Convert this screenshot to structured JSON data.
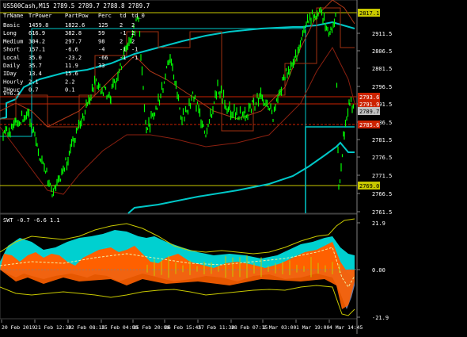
{
  "header": {
    "symbol_line": "US500Cash,M15  2789.5 2789.7 2788.8 2789.7"
  },
  "stats": {
    "columns": [
      "TrName",
      "TrPower",
      "PartPow",
      "Perc",
      "td",
      "td_0"
    ],
    "rows": [
      [
        "Basic",
        "1459.8",
        "1822.6",
        "125",
        "2",
        "2"
      ],
      [
        "Long",
        "616.9",
        "382.8",
        "59",
        "-1",
        "2"
      ],
      [
        "Medium",
        "304.2",
        "297.7",
        "98",
        "2",
        "2"
      ],
      [
        "Short",
        "157.1",
        "-6.6",
        "-4",
        "-1",
        "-1"
      ],
      [
        "Local",
        "35.0",
        "-23.2",
        "-66",
        "-1",
        "-1"
      ],
      [
        "Daily",
        "35.7",
        "11.9",
        "33",
        "",
        ""
      ],
      [
        "IDay",
        "13.4",
        "15.6",
        "",
        "",
        ""
      ],
      [
        "Hourly",
        "2.1",
        "2.2",
        "",
        "",
        ""
      ],
      [
        "IHour",
        "0.7",
        "0.1",
        "",
        "",
        ""
      ]
    ],
    "footer": "V=6.3"
  },
  "price_axis": {
    "ticks": [
      "2911.5",
      "2806.5",
      "2801.5",
      "2796.5",
      "2791.5",
      "2786.5",
      "2781.5",
      "2776.5",
      "2771.5",
      "2766.5",
      "2761.5"
    ],
    "tags": [
      {
        "text": "2817.1",
        "bg": "#c8c800",
        "fg": "#000000"
      },
      {
        "text": "2793.6",
        "bg": "#cc2200",
        "fg": "#ffffff"
      },
      {
        "text": "2791.9",
        "bg": "#cc2200",
        "fg": "#ffffff"
      },
      {
        "text": "2789.7",
        "bg": "#c0c0c0",
        "fg": "#000000"
      },
      {
        "text": "2785.6",
        "bg": "#cc2200",
        "fg": "#ffffff"
      },
      {
        "text": "2769.0",
        "bg": "#c8c800",
        "fg": "#000000"
      }
    ]
  },
  "sub_window": {
    "label": "SWT -0.7 -6.6 1.1",
    "ticks": [
      "21.9",
      "0.00",
      "-21.9"
    ]
  },
  "time_axis": {
    "labels": [
      "20 Feb 2019",
      "21 Feb 12:30",
      "22 Feb 08:15",
      "25 Feb 04:00",
      "25 Feb 20:00",
      "26 Feb 15:45",
      "27 Feb 11:30",
      "28 Feb 07:15",
      "1 Mar 03:00",
      "1 Mar 19:00",
      "4 Mar 14:45"
    ]
  },
  "colors": {
    "background": "#000000",
    "candles": "#00ff00",
    "band": "#00c8c8",
    "level_yellow": "#c8c800",
    "level_red": "#cc2200",
    "trend_line": "#a03010",
    "fill_cyan": "#00d0d0",
    "fill_orange": "#ff6000",
    "fill_blue": "#8090c0",
    "grid": "#404040"
  }
}
